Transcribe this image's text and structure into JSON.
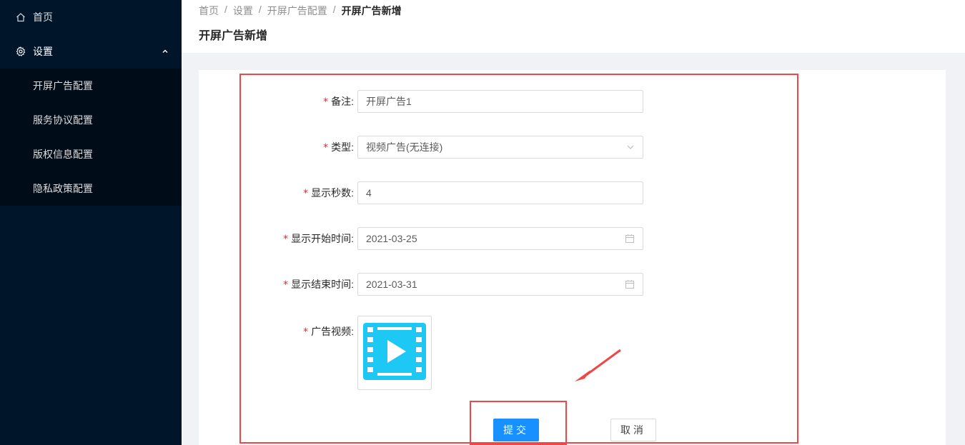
{
  "sidebar": {
    "items": [
      {
        "label": "首页",
        "icon": "home-icon"
      },
      {
        "label": "设置",
        "icon": "gear-icon",
        "open": true
      }
    ],
    "submenu": [
      {
        "label": "开屏广告配置"
      },
      {
        "label": "服务协议配置"
      },
      {
        "label": "版权信息配置"
      },
      {
        "label": "隐私政策配置"
      }
    ]
  },
  "breadcrumb": [
    "首页",
    "设置",
    "开屏广告配置",
    "开屏广告新增"
  ],
  "page_title": "开屏广告新增",
  "form": {
    "remark": {
      "label": "备注:",
      "value": "开屏广告1"
    },
    "type": {
      "label": "类型:",
      "value": "视频广告(无连接)"
    },
    "seconds": {
      "label": "显示秒数:",
      "value": "4"
    },
    "start_time": {
      "label": "显示开始时间:",
      "value": "2021-03-25"
    },
    "end_time": {
      "label": "显示结束时间:",
      "value": "2021-03-31"
    },
    "video": {
      "label": "广告视频:"
    },
    "required_mark": "*"
  },
  "buttons": {
    "submit": "提交",
    "cancel": "取消"
  },
  "colors": {
    "sidebar_bg": "#001529",
    "primary": "#1890ff",
    "required": "#f5222d",
    "annotation": "#f04646",
    "video_icon": "#1ec8f5"
  }
}
